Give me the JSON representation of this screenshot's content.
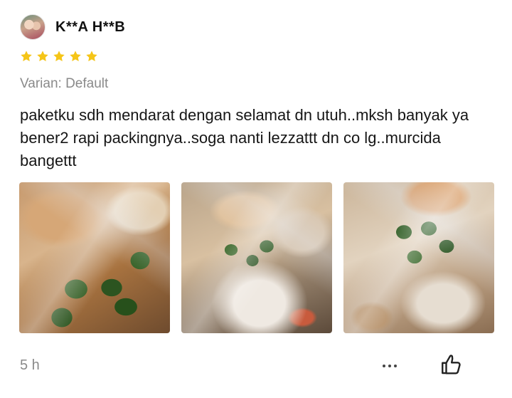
{
  "reviewer": {
    "name": "K**A H**B",
    "avatar_icon": "reviewer-avatar"
  },
  "rating": {
    "value": 5,
    "max": 5,
    "color": "#f5c518"
  },
  "variant": "Varian: Default",
  "review_text": "paketku sdh mendarat dengan selamat dn utuh..mksh banyak ya bener2 rapi packingnya..soga nanti lezzattt dn co lg..murcida bangettt",
  "photos": [
    {
      "icon": "review-photo-1"
    },
    {
      "icon": "review-photo-2"
    },
    {
      "icon": "review-photo-3"
    }
  ],
  "footer": {
    "timestamp": "5 h",
    "more_icon": "more-options-icon",
    "like_icon": "thumbs-up-icon"
  }
}
